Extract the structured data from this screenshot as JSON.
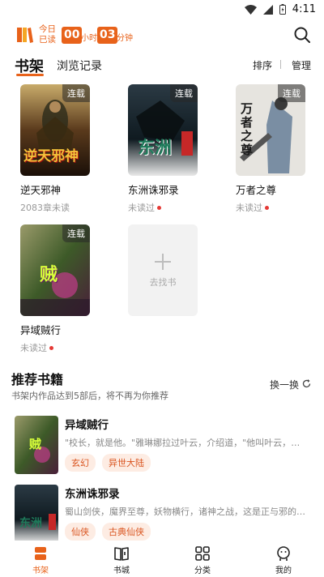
{
  "status_bar": {
    "time": "4:11"
  },
  "header": {
    "today_label_1": "今日",
    "today_label_2": "已读",
    "hours": "00",
    "hours_unit": "小时",
    "minutes": "03",
    "minutes_unit": "分钟"
  },
  "tabs": {
    "shelf": "书架",
    "history": "浏览记录",
    "sort": "排序",
    "manage": "管理"
  },
  "books": [
    {
      "title": "逆天邪神",
      "status": "2083章未读",
      "badge": "连载",
      "unread_dot": false,
      "cover_text": "逆天邪神"
    },
    {
      "title": "东洲诛邪录",
      "status": "未读过",
      "badge": "连载",
      "unread_dot": true,
      "cover_text": "东洲"
    },
    {
      "title": "万者之尊",
      "status": "未读过",
      "badge": "连载",
      "unread_dot": true,
      "cover_text": "万者之尊"
    },
    {
      "title": "异域贼行",
      "status": "未读过",
      "badge": "连载",
      "unread_dot": true,
      "cover_text": "贼"
    }
  ],
  "add_book": {
    "label": "去找书"
  },
  "recommend": {
    "title": "推荐书籍",
    "subtitle": "书架内作品达到5部后，将不再为你推荐",
    "refresh": "换一换",
    "items": [
      {
        "name": "异域贼行",
        "desc": "\"校长，就是他。\"雅琳娜拉过叶云，介绍道，\"他叫叶云，我父...",
        "tags": [
          "玄幻",
          "异世大陆"
        ]
      },
      {
        "name": "东洲诛邪录",
        "desc": "蜀山剑侠，魔界至尊，妖物横行，诸神之战，这是正与邪的辩...",
        "tags": [
          "仙侠",
          "古典仙侠"
        ]
      }
    ]
  },
  "nav": [
    {
      "label": "书架",
      "active": true
    },
    {
      "label": "书城",
      "active": false
    },
    {
      "label": "分类",
      "active": false
    },
    {
      "label": "我的",
      "active": false
    }
  ],
  "colors": {
    "accent": "#e8621a",
    "tag_bg": "#fdece3",
    "dot": "#e53935"
  }
}
